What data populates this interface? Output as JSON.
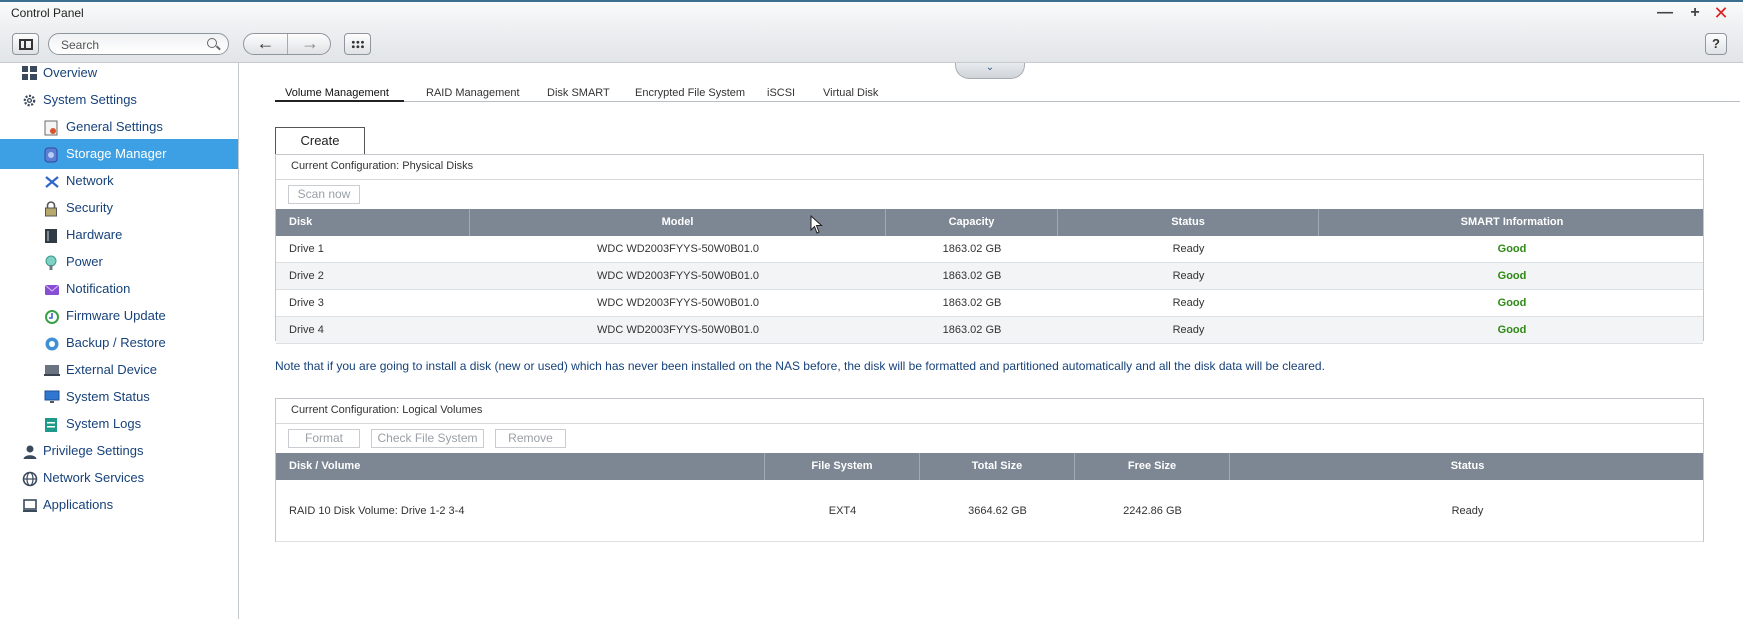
{
  "window": {
    "title": "Control Panel",
    "minimize_glyph": "—",
    "maximize_glyph": "+",
    "close_glyph": "✕"
  },
  "toolbar": {
    "search_placeholder": "Search",
    "back_glyph": "←",
    "forward_glyph": "→",
    "help_label": "?"
  },
  "sidebar": {
    "items": [
      {
        "label": "Overview",
        "level": "top",
        "icon": "overview-icon",
        "active": false
      },
      {
        "label": "System Settings",
        "level": "top",
        "icon": "gear-icon",
        "active": false
      },
      {
        "label": "General Settings",
        "level": "sub",
        "icon": "general-settings-icon",
        "active": false
      },
      {
        "label": "Storage Manager",
        "level": "sub",
        "icon": "storage-icon",
        "active": true
      },
      {
        "label": "Network",
        "level": "sub",
        "icon": "network-icon",
        "active": false
      },
      {
        "label": "Security",
        "level": "sub",
        "icon": "lock-icon",
        "active": false
      },
      {
        "label": "Hardware",
        "level": "sub",
        "icon": "hardware-icon",
        "active": false
      },
      {
        "label": "Power",
        "level": "sub",
        "icon": "power-icon",
        "active": false
      },
      {
        "label": "Notification",
        "level": "sub",
        "icon": "notification-icon",
        "active": false
      },
      {
        "label": "Firmware Update",
        "level": "sub",
        "icon": "firmware-icon",
        "active": false
      },
      {
        "label": "Backup / Restore",
        "level": "sub",
        "icon": "backup-icon",
        "active": false
      },
      {
        "label": "External Device",
        "level": "sub",
        "icon": "external-device-icon",
        "active": false
      },
      {
        "label": "System Status",
        "level": "sub",
        "icon": "monitor-icon",
        "active": false
      },
      {
        "label": "System Logs",
        "level": "sub",
        "icon": "logs-icon",
        "active": false
      },
      {
        "label": "Privilege Settings",
        "level": "top",
        "icon": "user-icon",
        "active": false
      },
      {
        "label": "Network Services",
        "level": "top",
        "icon": "network-services-icon",
        "active": false
      },
      {
        "label": "Applications",
        "level": "top",
        "icon": "applications-icon",
        "active": false
      }
    ]
  },
  "tabs": [
    {
      "label": "Volume Management",
      "active": true
    },
    {
      "label": "RAID Management",
      "active": false
    },
    {
      "label": "Disk SMART",
      "active": false
    },
    {
      "label": "Encrypted File System",
      "active": false
    },
    {
      "label": "iSCSI",
      "active": false
    },
    {
      "label": "Virtual Disk",
      "active": false
    }
  ],
  "main": {
    "collapse_glyph": "⌄",
    "create_label": "Create",
    "physical": {
      "title": "Current Configuration: Physical Disks",
      "scan_label": "Scan now",
      "headers": [
        "Disk",
        "Model",
        "Capacity",
        "Status",
        "SMART Information"
      ],
      "rows": [
        [
          "Drive 1",
          "WDC WD2003FYYS-50W0B01.0",
          "1863.02 GB",
          "Ready",
          "Good"
        ],
        [
          "Drive 2",
          "WDC WD2003FYYS-50W0B01.0",
          "1863.02 GB",
          "Ready",
          "Good"
        ],
        [
          "Drive 3",
          "WDC WD2003FYYS-50W0B01.0",
          "1863.02 GB",
          "Ready",
          "Good"
        ],
        [
          "Drive 4",
          "WDC WD2003FYYS-50W0B01.0",
          "1863.02 GB",
          "Ready",
          "Good"
        ]
      ]
    },
    "note": "Note that if you are going to install a disk (new or used) which has never been installed on the NAS before, the disk will be formatted and partitioned automatically and all the disk data will be cleared.",
    "logical": {
      "title": "Current Configuration: Logical Volumes",
      "format_label": "Format",
      "check_label": "Check File System",
      "remove_label": "Remove",
      "headers": [
        "Disk / Volume",
        "File System",
        "Total Size",
        "Free Size",
        "Status"
      ],
      "rows": [
        [
          "RAID 10 Disk Volume: Drive 1-2 3-4",
          "EXT4",
          "3664.62 GB",
          "2242.86 GB",
          "Ready"
        ]
      ]
    }
  },
  "colors": {
    "active_nav": "#3ea0e4",
    "table_header": "#7d8693",
    "good_status": "#2e8a16",
    "nav_text": "#17427a"
  }
}
